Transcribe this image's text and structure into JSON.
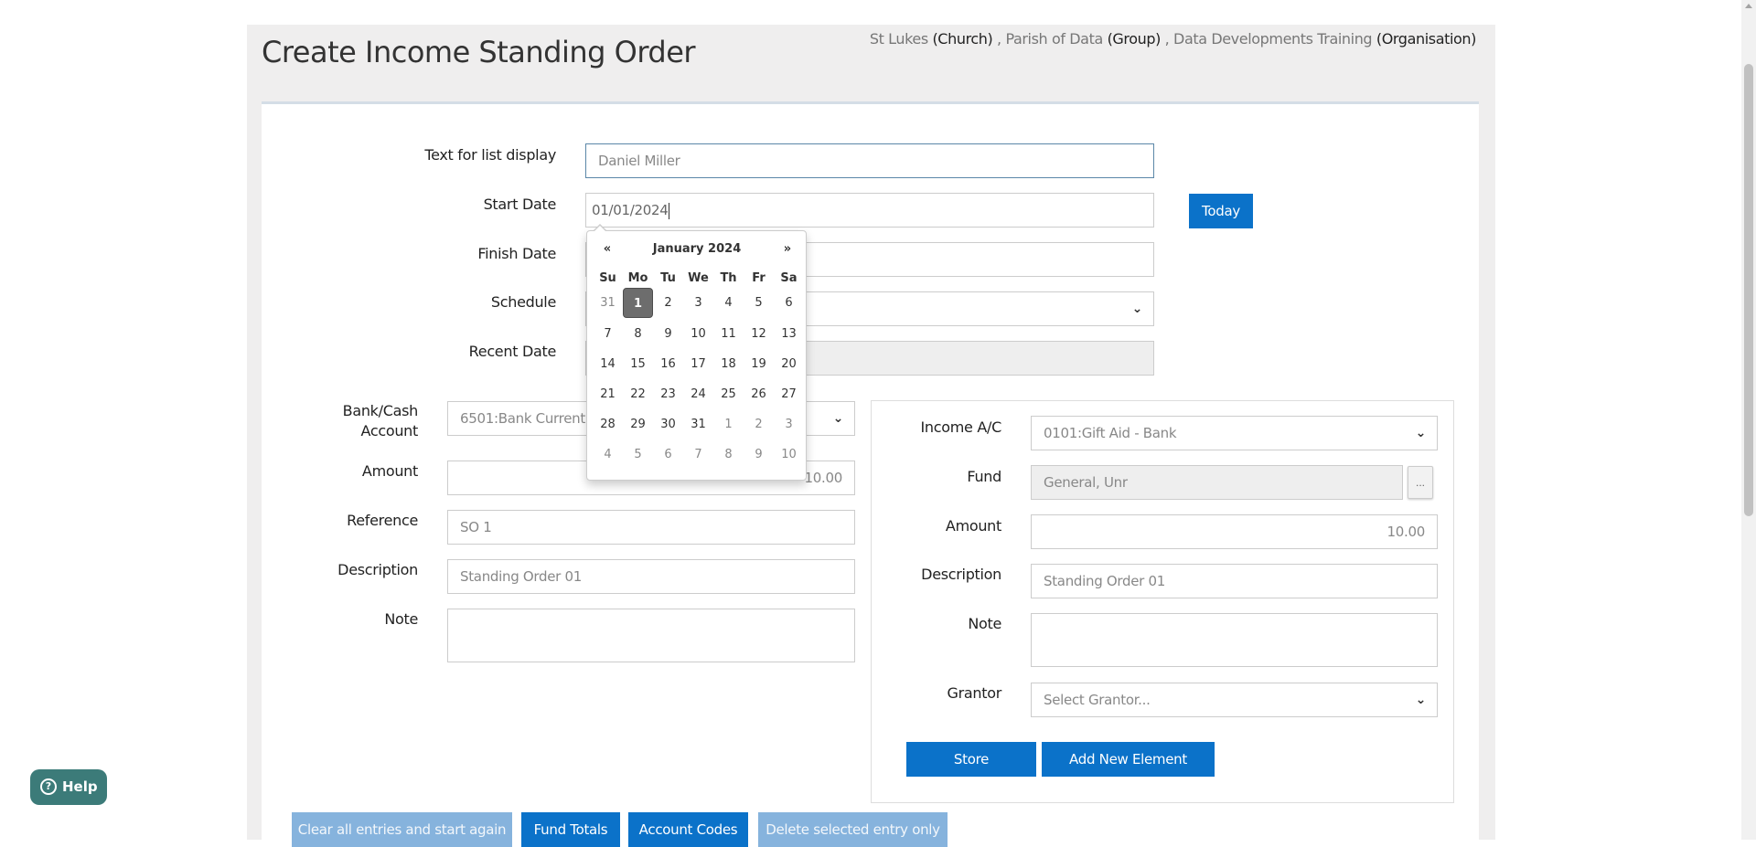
{
  "header": {
    "title": "Create Income Standing Order",
    "context": [
      {
        "name": "St Lukes",
        "type": "(Church)",
        "sep": " , "
      },
      {
        "name": "Parish of Data",
        "type": "(Group)",
        "sep": " , "
      },
      {
        "name": "Data Developments Training",
        "type": "(Organisation)",
        "sep": ""
      }
    ]
  },
  "form": {
    "text_for_list_display": {
      "label": "Text for list display",
      "value": "Daniel Miller"
    },
    "start_date": {
      "label": "Start Date",
      "value": "01/01/2024"
    },
    "today_button": "Today",
    "finish_date": {
      "label": "Finish Date",
      "value": ""
    },
    "schedule": {
      "label": "Schedule",
      "value": ""
    },
    "recent_date": {
      "label": "Recent Date",
      "value": ""
    }
  },
  "left": {
    "bank_label_1": "Bank/Cash",
    "bank_label_2": "Account",
    "bank_value": "6501:Bank Current",
    "amount_label": "Amount",
    "amount_value": "10.00",
    "reference_label": "Reference",
    "reference_value": "SO 1",
    "description_label": "Description",
    "description_value": "Standing Order 01",
    "note_label": "Note",
    "note_value": ""
  },
  "right": {
    "income_ac_label": "Income A/C",
    "income_ac_value": "0101:Gift Aid - Bank",
    "fund_label": "Fund",
    "fund_value": "General, Unr",
    "fund_button": "...",
    "amount_label": "Amount",
    "amount_value": "10.00",
    "description_label": "Description",
    "description_value": "Standing Order 01",
    "note_label": "Note",
    "note_value": "",
    "grantor_label": "Grantor",
    "grantor_placeholder": "Select Grantor...",
    "store_button": "Store",
    "add_element_button": "Add New Element"
  },
  "bottom_buttons": {
    "clear": "Clear all entries and start again",
    "fund_totals": "Fund Totals",
    "account_codes": "Account Codes",
    "delete_selected": "Delete selected entry only"
  },
  "help": {
    "label": "Help",
    "icon": "question-circle-icon"
  },
  "datepicker": {
    "prev": "«",
    "next": "»",
    "month_year": "January 2024",
    "days_of_week": [
      "Su",
      "Mo",
      "Tu",
      "We",
      "Th",
      "Fr",
      "Sa"
    ],
    "weeks": [
      [
        "31",
        "1",
        "2",
        "3",
        "4",
        "5",
        "6"
      ],
      [
        "7",
        "8",
        "9",
        "10",
        "11",
        "12",
        "13"
      ],
      [
        "14",
        "15",
        "16",
        "17",
        "18",
        "19",
        "20"
      ],
      [
        "21",
        "22",
        "23",
        "24",
        "25",
        "26",
        "27"
      ],
      [
        "28",
        "29",
        "30",
        "31",
        "1",
        "2",
        "3"
      ],
      [
        "4",
        "5",
        "6",
        "7",
        "8",
        "9",
        "10"
      ]
    ],
    "selected": "1"
  },
  "colors": {
    "primary_button": "#0b72c9",
    "disabled_button": "#86b3dd",
    "help_button": "#3c7b79",
    "selected_day": "#6d6d6d"
  }
}
